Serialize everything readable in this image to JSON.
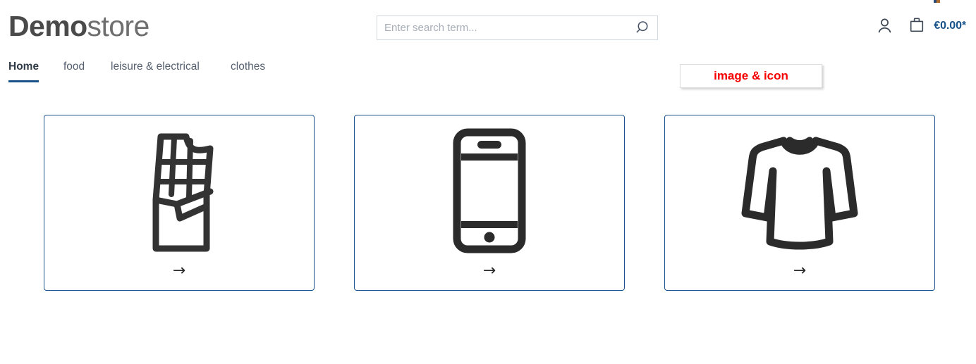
{
  "header": {
    "logo": {
      "bold_part": "Demo",
      "light_part": "store"
    },
    "search": {
      "placeholder": "Enter search term...",
      "value": "",
      "icon": "search-icon"
    },
    "account": {
      "icon": "person-icon"
    },
    "cart": {
      "icon": "shopping-bag-icon",
      "price": "€0.00*"
    }
  },
  "nav": {
    "items": [
      {
        "label": "Home",
        "active": true
      },
      {
        "label": "food",
        "active": false
      },
      {
        "label": "leisure & electrical",
        "active": false
      },
      {
        "label": "clothes",
        "active": false
      }
    ]
  },
  "tooltip": {
    "text": "image & icon"
  },
  "cards": [
    {
      "icon": "chocolate-bar-icon",
      "arrow": "→"
    },
    {
      "icon": "smartphone-icon",
      "arrow": "→"
    },
    {
      "icon": "long-sleeve-shirt-icon",
      "arrow": "→"
    }
  ],
  "colors": {
    "accent_blue": "#17528a",
    "card_border": "#1a5490",
    "tooltip_red": "#f60000",
    "icon_dark": "#333333",
    "logo_bold": "#4a4a4a",
    "logo_light": "#6e6e6e"
  }
}
